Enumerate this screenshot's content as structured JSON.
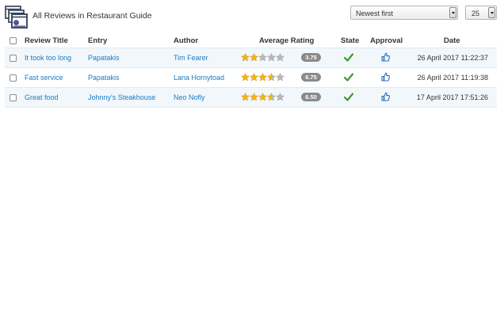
{
  "page": {
    "title": "All Reviews in Restaurant Guide"
  },
  "controls": {
    "sort": {
      "selected": "Newest first"
    },
    "limit": {
      "selected": "25"
    }
  },
  "table": {
    "headers": {
      "review_title": "Review Title",
      "entry": "Entry",
      "author": "Author",
      "average_rating": "Average Rating",
      "state": "State",
      "approval": "Approval",
      "date": "Date"
    },
    "rows": [
      {
        "title": "It took too long",
        "entry": "Papatakis",
        "author": "Tim Fearer",
        "stars": 2,
        "rating": "3.75",
        "state": "published",
        "approval": "approved",
        "date": "26 April 2017 11:22:37"
      },
      {
        "title": "Fast service",
        "entry": "Papatakis",
        "author": "Lana Hornytoad",
        "stars": 3.5,
        "rating": "6.75",
        "state": "published",
        "approval": "approved",
        "date": "26 April 2017 11:19:38"
      },
      {
        "title": "Great food",
        "entry": "Johnny's Steakhouse",
        "author": "Neo Nofly",
        "stars": 3.5,
        "rating": "6.50",
        "state": "published",
        "approval": "approved",
        "date": "17 April 2017 17:51:26"
      }
    ]
  },
  "colors": {
    "link": "#1a7bc1",
    "star_filled": "#f5b21b",
    "star_empty": "#b8b8b8",
    "check": "#3c9a2f",
    "thumb": "#2f6fbf",
    "badge": "#8a8a8a",
    "row_alt": "#f2f7fb"
  },
  "icons": {
    "app": "reviews-app-icon",
    "state": "check-icon",
    "approval": "thumbs-up-icon",
    "star": "star-icon"
  }
}
